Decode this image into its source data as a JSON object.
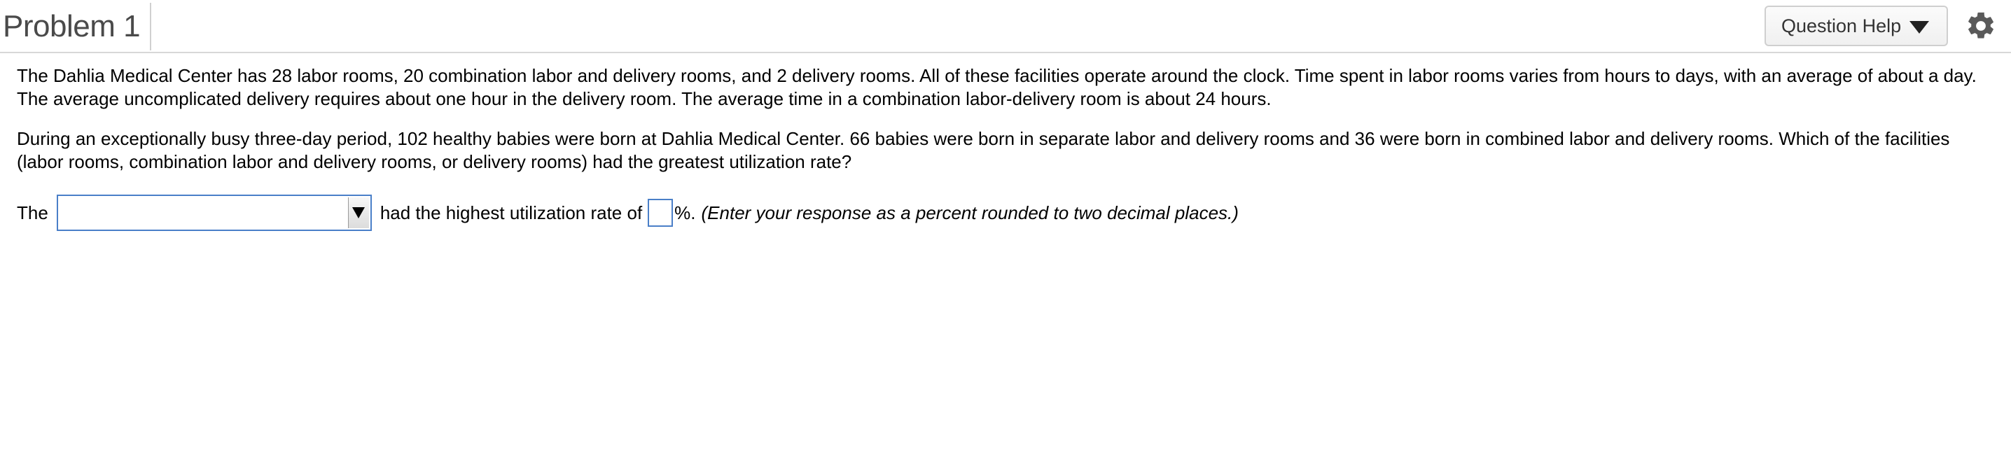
{
  "header": {
    "title": "Problem 1",
    "question_help_label": "Question Help"
  },
  "problem": {
    "paragraph1": "The Dahlia Medical Center has 28 labor rooms, 20 combination labor and delivery rooms, and 2 delivery rooms. All of these facilities operate around the clock. Time spent in labor rooms varies from hours to days, with an average of about a day. The average uncomplicated delivery requires about one hour in the delivery room. The average time in a combination labor-delivery room is about 24 hours.",
    "paragraph2": "During an exceptionally busy three-day period, 102 healthy babies were born at Dahlia Medical Center. 66 babies were born in separate labor and delivery rooms and 36 were born in combined labor and delivery rooms. Which of the facilities (labor rooms, combination labor and delivery rooms, or delivery rooms) had the greatest utilization rate?"
  },
  "answer": {
    "prefix": "The",
    "selected_value": "",
    "middle": "had the highest utilization rate of",
    "percent_value": "",
    "percent_sign": "%.",
    "instruction": "(Enter your response as a percent rounded to two decimal places.)"
  },
  "icons": {
    "help_caret": "caret-down-icon",
    "settings": "gear-icon",
    "select_arrow": "dropdown-arrow-icon"
  },
  "colors": {
    "input_border": "#4a7fc8",
    "title": "#4a4a4a"
  }
}
